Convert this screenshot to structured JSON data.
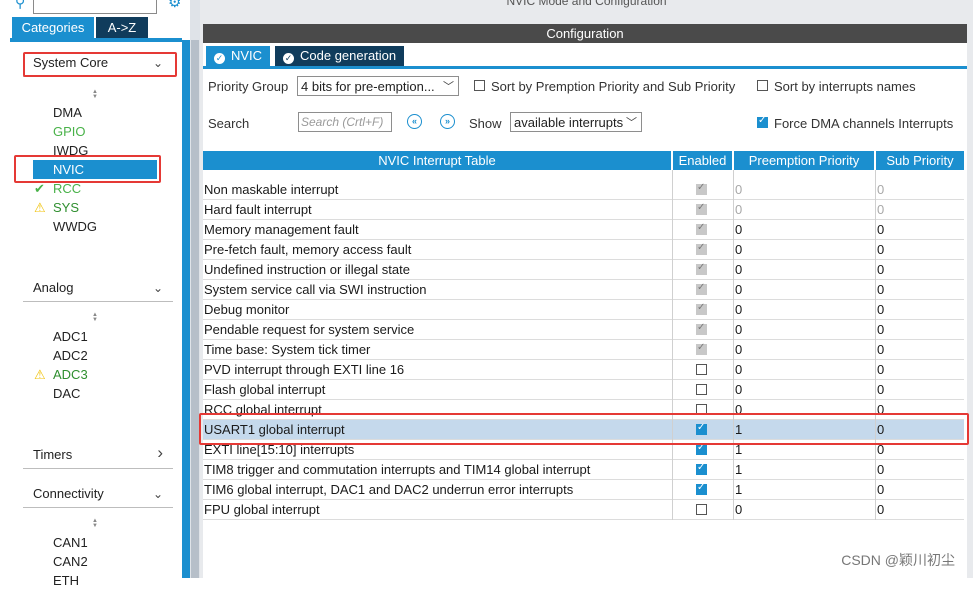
{
  "left": {
    "tabs": [
      "Categories",
      "A->Z"
    ],
    "sections": [
      {
        "title": "System Core",
        "chevron": "chevron-down",
        "items": [
          {
            "label": "DMA",
            "status": "none"
          },
          {
            "label": "GPIO",
            "status": "green"
          },
          {
            "label": "IWDG",
            "status": "none"
          },
          {
            "label": "NVIC",
            "status": "selected"
          },
          {
            "label": "RCC",
            "status": "check"
          },
          {
            "label": "SYS",
            "status": "warning"
          },
          {
            "label": "WWDG",
            "status": "none"
          }
        ]
      },
      {
        "title": "Analog",
        "chevron": "chevron-down",
        "items": [
          {
            "label": "ADC1",
            "status": "none"
          },
          {
            "label": "ADC2",
            "status": "none"
          },
          {
            "label": "ADC3",
            "status": "warning"
          },
          {
            "label": "DAC",
            "status": "none"
          }
        ]
      },
      {
        "title": "Timers",
        "chevron": "chevron-right",
        "items": []
      },
      {
        "title": "Connectivity",
        "chevron": "chevron-down",
        "items": [
          {
            "label": "CAN1",
            "status": "none"
          },
          {
            "label": "CAN2",
            "status": "none"
          },
          {
            "label": "ETH",
            "status": "none"
          }
        ]
      }
    ]
  },
  "right": {
    "mode_title": "NVIC Mode and Configuration",
    "config_title": "Configuration",
    "tabs": [
      "NVIC",
      "Code generation"
    ],
    "priority_group_label": "Priority Group",
    "priority_group_value": "4 bits for pre-emption...",
    "sort_premption_label": "Sort by Premption Priority and Sub Priority",
    "sort_names_label": "Sort by interrupts names",
    "search_label": "Search",
    "search_placeholder": "Search (Crtl+F)",
    "show_label": "Show",
    "show_value": "available interrupts",
    "force_dma_label": "Force DMA channels Interrupts",
    "table": {
      "headers": [
        "NVIC Interrupt Table",
        "Enabled",
        "Preemption Priority",
        "Sub Priority"
      ],
      "rows": [
        {
          "name": "Non maskable interrupt",
          "enabled": "locked",
          "pre": "0",
          "sub": "0",
          "gray": true
        },
        {
          "name": "Hard fault interrupt",
          "enabled": "locked",
          "pre": "0",
          "sub": "0",
          "gray": true
        },
        {
          "name": "Memory management fault",
          "enabled": "locked",
          "pre": "0",
          "sub": "0",
          "gray": false
        },
        {
          "name": "Pre-fetch fault, memory access fault",
          "enabled": "locked",
          "pre": "0",
          "sub": "0",
          "gray": false
        },
        {
          "name": "Undefined instruction or illegal state",
          "enabled": "locked",
          "pre": "0",
          "sub": "0",
          "gray": false
        },
        {
          "name": "System service call via SWI instruction",
          "enabled": "locked",
          "pre": "0",
          "sub": "0",
          "gray": false
        },
        {
          "name": "Debug monitor",
          "enabled": "locked",
          "pre": "0",
          "sub": "0",
          "gray": false
        },
        {
          "name": "Pendable request for system service",
          "enabled": "locked",
          "pre": "0",
          "sub": "0",
          "gray": false
        },
        {
          "name": "Time base: System tick timer",
          "enabled": "locked",
          "pre": "0",
          "sub": "0",
          "gray": false
        },
        {
          "name": "PVD interrupt through EXTI line 16",
          "enabled": "off",
          "pre": "0",
          "sub": "0",
          "gray": false
        },
        {
          "name": "Flash global interrupt",
          "enabled": "off",
          "pre": "0",
          "sub": "0",
          "gray": false
        },
        {
          "name": "RCC global interrupt",
          "enabled": "off",
          "pre": "0",
          "sub": "0",
          "gray": false
        },
        {
          "name": "USART1 global interrupt",
          "enabled": "on",
          "pre": "1",
          "sub": "0",
          "gray": false,
          "selected": true
        },
        {
          "name": "EXTI line[15:10] interrupts",
          "enabled": "on",
          "pre": "1",
          "sub": "0",
          "gray": false
        },
        {
          "name": "TIM8 trigger and commutation interrupts and TIM14 global interrupt",
          "enabled": "on",
          "pre": "1",
          "sub": "0",
          "gray": false
        },
        {
          "name": "TIM6 global interrupt, DAC1 and DAC2 underrun error interrupts",
          "enabled": "on",
          "pre": "1",
          "sub": "0",
          "gray": false
        },
        {
          "name": "FPU global interrupt",
          "enabled": "off",
          "pre": "0",
          "sub": "0",
          "gray": false
        }
      ]
    }
  },
  "watermark": "CSDN @颖川初尘",
  "colors": {
    "accent": "#1b8fcf",
    "highlight": "#e53935",
    "selected_row": "#c5d9ec",
    "ok_green": "#49b249",
    "warning": "#f0c20a"
  }
}
